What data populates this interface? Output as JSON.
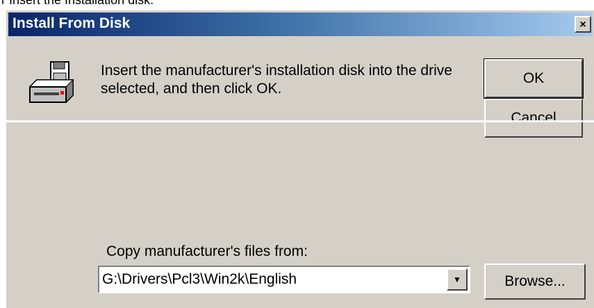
{
  "page": {
    "caption": "r Insert the Installation disk."
  },
  "dialog": {
    "title": "Install From Disk",
    "close_label": "×",
    "icon": "floppy-drive-icon",
    "message": "Insert the manufacturer's installation disk into the drive selected, and then click OK.",
    "ok_label": "OK",
    "cancel_label": "Cancel",
    "copy_label": "Copy manufacturer's files from:",
    "path_value": "G:\\Drivers\\Pcl3\\Win2k\\English",
    "dropdown_arrow": "▼",
    "browse_label": "Browse..."
  },
  "colors": {
    "face": "#d4d0c8",
    "title_start": "#0a246a",
    "title_end": "#a6caf0"
  }
}
